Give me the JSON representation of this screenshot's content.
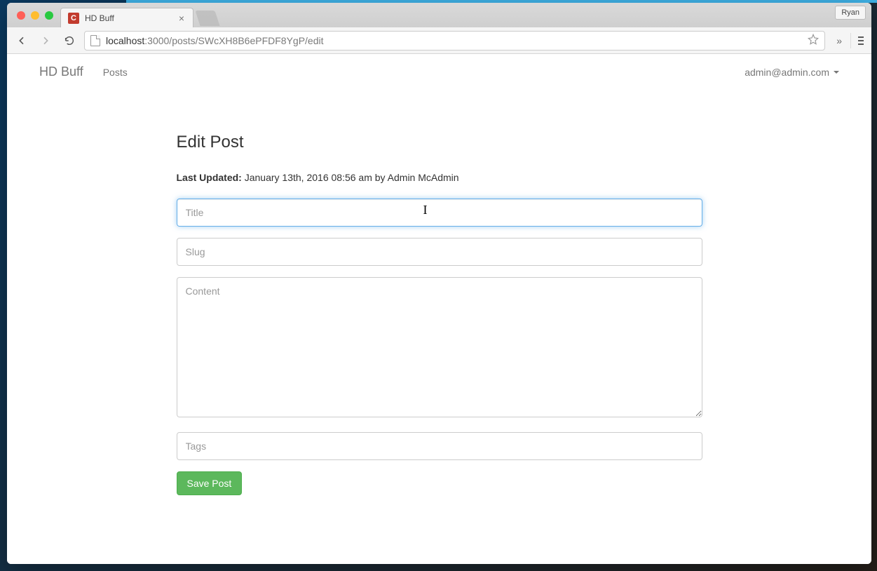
{
  "browser": {
    "profile_name": "Ryan",
    "tab": {
      "title": "HD Buff",
      "favicon_letter": "C"
    },
    "url": {
      "host": "localhost",
      "path": ":3000/posts/SWcXH8B6ePFDF8YgP/edit"
    }
  },
  "app": {
    "brand": "HD Buff",
    "nav": {
      "posts": "Posts"
    },
    "user_email": "admin@admin.com"
  },
  "page": {
    "heading": "Edit Post",
    "last_updated_label": "Last Updated:",
    "last_updated_value": " January 13th, 2016 08:56 am by Admin McAdmin",
    "fields": {
      "title": {
        "placeholder": "Title",
        "value": ""
      },
      "slug": {
        "placeholder": "Slug",
        "value": ""
      },
      "content": {
        "placeholder": "Content",
        "value": ""
      },
      "tags": {
        "placeholder": "Tags",
        "value": ""
      }
    },
    "save_button": "Save Post"
  }
}
